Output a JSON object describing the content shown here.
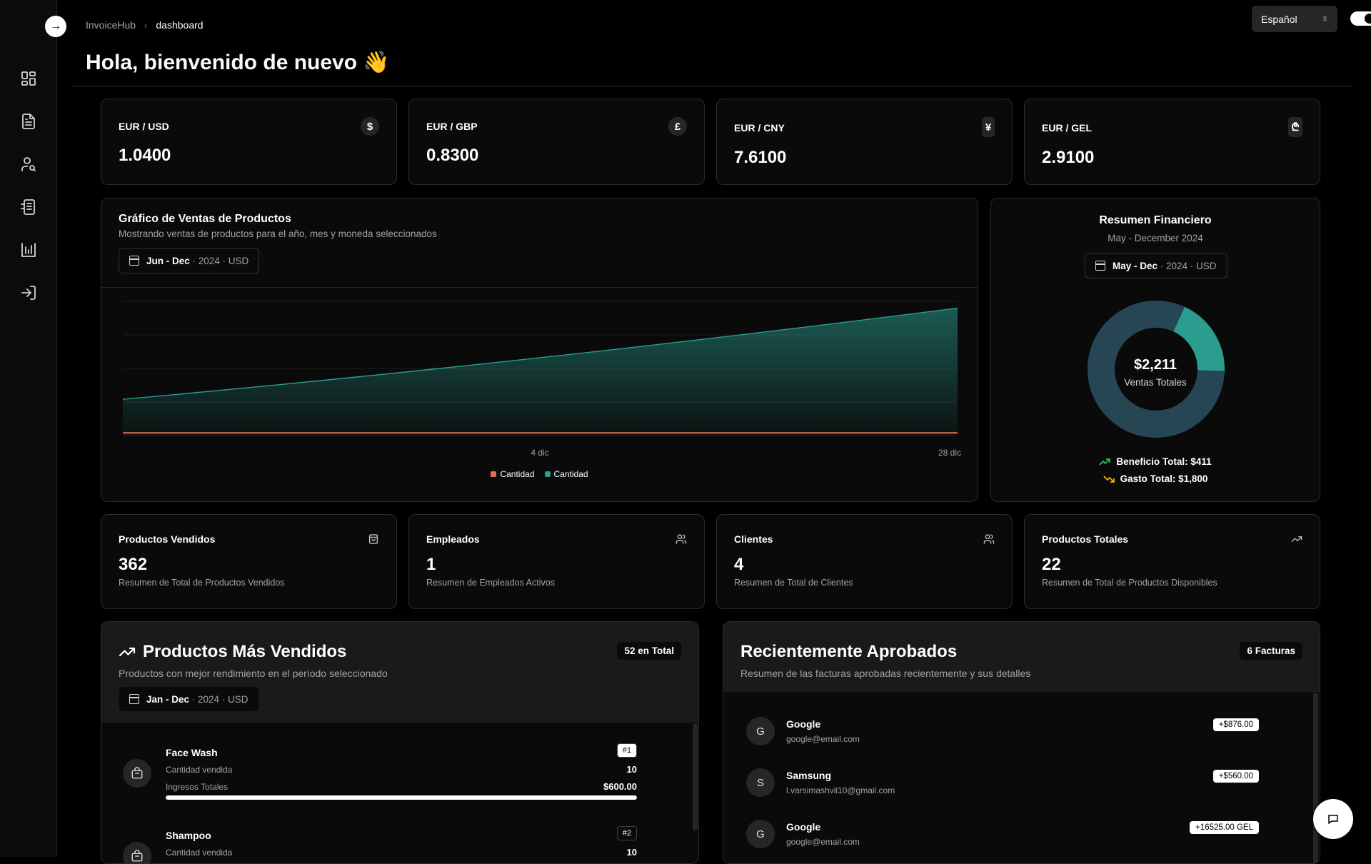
{
  "app": {
    "name": "InvoiceHub",
    "current_page": "dashboard",
    "breadcrumb_sep": "›"
  },
  "greeting": "Hola, bienvenido de nuevo 👋",
  "header": {
    "language": "Español",
    "sidebar_toggle_glyph": "→",
    "dark_mode": true
  },
  "sidebar": {
    "items": [
      {
        "icon": "dashboard-icon"
      },
      {
        "icon": "invoice-icon"
      },
      {
        "icon": "user-search-icon"
      },
      {
        "icon": "receipt-icon"
      },
      {
        "icon": "reports-icon"
      },
      {
        "icon": "logout-icon"
      }
    ]
  },
  "rates": [
    {
      "label": "EUR / USD",
      "value": "1.0400",
      "symbol": "$"
    },
    {
      "label": "EUR / GBP",
      "value": "0.8300",
      "symbol": "£"
    },
    {
      "label": "EUR / CNY",
      "value": "7.6100",
      "symbol": "¥"
    },
    {
      "label": "EUR / GEL",
      "value": "2.9100",
      "symbol": "₾"
    }
  ],
  "sales_chart": {
    "title": "Gráfico de Ventas de Productos",
    "subtitle": "Mostrando ventas de productos para el año, mes y moneda seleccionados",
    "range_months": "Jun - Dec",
    "range_rest": " · 2024 · USD"
  },
  "chart_data": {
    "type": "area",
    "x_ticks": [
      "4 dic",
      "28 dic"
    ],
    "x": [
      "start",
      "4 dic",
      "28 dic"
    ],
    "series": [
      {
        "name": "Cantidad",
        "color": "#e76e50",
        "values": [
          0.02,
          0.02,
          0.02
        ]
      },
      {
        "name": "Cantidad",
        "color": "#2a9d8f",
        "values": [
          0.27,
          0.55,
          0.95
        ]
      }
    ],
    "ylim": [
      0,
      1
    ],
    "grid": true,
    "legend": "bottom-center"
  },
  "financial": {
    "title": "Resumen Financiero",
    "subtitle": "May - December 2024",
    "range_months": "May - Dec",
    "range_rest": " · 2024 · USD",
    "total": "$2,211",
    "total_label": "Ventas Totales",
    "profit": "Beneficio Total: $411",
    "expense": "Gasto Total: $1,800",
    "donut": [
      {
        "name": "profit",
        "value": 411,
        "color": "#2a9d8f"
      },
      {
        "name": "expense",
        "value": 1800,
        "color": "#264653"
      }
    ],
    "profit_color": "#22c55e",
    "expense_color": "#eab308"
  },
  "stats": [
    {
      "label": "Productos Vendidos",
      "value": "362",
      "desc": "Resumen de Total de Productos Vendidos",
      "icon": "shopping-bag-icon"
    },
    {
      "label": "Empleados",
      "value": "1",
      "desc": "Resumen de Empleados Activos",
      "icon": "users-icon"
    },
    {
      "label": "Clientes",
      "value": "4",
      "desc": "Resumen de Total de Clientes",
      "icon": "users-icon"
    },
    {
      "label": "Productos Totales",
      "value": "22",
      "desc": "Resumen de Total de Productos Disponibles",
      "icon": "trending-up-icon"
    }
  ],
  "top_products": {
    "title": "Productos Más Vendidos",
    "subtitle": "Productos con mejor rendimiento en el período seleccionado",
    "badge": "52 en Total",
    "range_months": "Jan - Dec",
    "range_rest": " · 2024 · USD",
    "items": [
      {
        "name": "Face Wash",
        "rank": "#1",
        "qty_label": "Cantidad vendida",
        "qty": "10",
        "rev_label": "Ingresos Totales",
        "revenue": "$600.00",
        "progress": 1.0
      },
      {
        "name": "Shampoo",
        "rank": "#2",
        "qty_label": "Cantidad vendida",
        "qty": "10"
      }
    ]
  },
  "recent": {
    "title": "Recientemente Aprobados",
    "subtitle": "Resumen de las facturas aprobadas recientemente y sus detalles",
    "badge": "6 Facturas",
    "items": [
      {
        "initial": "G",
        "name": "Google",
        "email": "google@email.com",
        "amount": "+$876.00"
      },
      {
        "initial": "S",
        "name": "Samsung",
        "email": "l.varsimashvil10@gmail.com",
        "amount": "+$560.00"
      },
      {
        "initial": "G",
        "name": "Google",
        "email": "google@email.com",
        "amount": "+16525.00 GEL"
      }
    ]
  }
}
